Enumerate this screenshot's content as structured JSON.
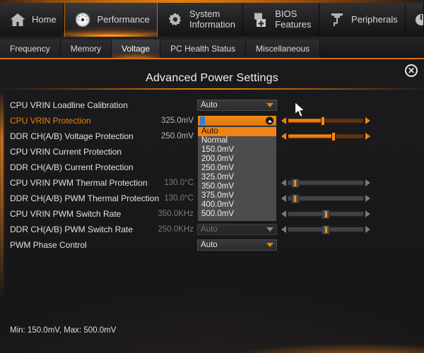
{
  "mainnav": [
    {
      "label": "Home",
      "icon": "home-icon",
      "active": false
    },
    {
      "label": "Performance",
      "icon": "gauge-icon",
      "active": true
    },
    {
      "label": "System\nInformation",
      "icon": "gear-icon",
      "active": false
    },
    {
      "label": "BIOS\nFeatures",
      "icon": "chip-plus-icon",
      "active": false
    },
    {
      "label": "Peripherals",
      "icon": "usb-plug-icon",
      "active": false
    },
    {
      "label": "",
      "icon": "power-icon",
      "active": false
    }
  ],
  "subtabs": [
    {
      "label": "Frequency",
      "active": false
    },
    {
      "label": "Memory",
      "active": false
    },
    {
      "label": "Voltage",
      "active": true
    },
    {
      "label": "PC Health Status",
      "active": false
    },
    {
      "label": "Miscellaneous",
      "active": false
    }
  ],
  "panel": {
    "title": "Advanced Power Settings",
    "close_label": "✕"
  },
  "settings": [
    {
      "label": "CPU VRIN Loadline Calibration",
      "value": "",
      "control": "combo",
      "combo_value": "Auto",
      "disabled": false,
      "selected": false,
      "slider": null
    },
    {
      "label": "CPU VRIN Protection",
      "value": "325.0mV",
      "control": "combo-open",
      "combo_value": "",
      "disabled": false,
      "selected": true,
      "slider": {
        "fill": 0.46,
        "knob": 0.46,
        "hot": true
      }
    },
    {
      "label": "DDR CH(A/B) Voltage Protection",
      "value": "250.0mV",
      "control": "none",
      "combo_value": "",
      "disabled": false,
      "selected": false,
      "slider": {
        "fill": 0.6,
        "knob": 0.6,
        "hot": true
      }
    },
    {
      "label": "CPU VRIN Current Protection",
      "value": "",
      "control": "none",
      "combo_value": "",
      "disabled": false,
      "selected": false,
      "slider": null
    },
    {
      "label": "DDR CH(A/B) Current Protection",
      "value": "",
      "control": "none",
      "combo_value": "",
      "disabled": false,
      "selected": false,
      "slider": null
    },
    {
      "label": "CPU VRIN PWM Thermal Protection",
      "value": "130.0°C",
      "control": "none",
      "combo_value": "",
      "disabled": true,
      "selected": false,
      "slider": {
        "fill": 0,
        "knob": 0.09,
        "hot": false
      }
    },
    {
      "label": "DDR CH(A/B) PWM Thermal Protection",
      "value": "130.0°C",
      "control": "none",
      "combo_value": "",
      "disabled": true,
      "selected": false,
      "slider": {
        "fill": 0,
        "knob": 0.09,
        "hot": false
      }
    },
    {
      "label": "CPU VRIN PWM Switch Rate",
      "value": "350.0KHz",
      "control": "none",
      "combo_value": "",
      "disabled": true,
      "selected": false,
      "slider": {
        "fill": 0,
        "knob": 0.5,
        "hot": false
      }
    },
    {
      "label": "DDR CH(A/B) PWM Switch Rate",
      "value": "250.0KHz",
      "control": "combo",
      "combo_value": "Auto",
      "disabled": true,
      "selected": false,
      "slider": {
        "fill": 0,
        "knob": 0.5,
        "hot": false
      }
    },
    {
      "label": "PWM Phase Control",
      "value": "",
      "control": "combo",
      "combo_value": "Auto",
      "disabled": false,
      "selected": false,
      "slider": null
    }
  ],
  "dropdown": {
    "open": true,
    "selected_index": 0,
    "options": [
      "Auto",
      "Normal",
      "150.0mV",
      "200.0mV",
      "250.0mV",
      "325.0mV",
      "350.0mV",
      "375.0mV",
      "400.0mV",
      "500.0mV"
    ]
  },
  "footer": {
    "text": "Min: 150.0mV, Max: 500.0mV"
  },
  "colors": {
    "accent": "#e8820f",
    "accent_bright": "#ff931f",
    "selected_text": "#e8820f",
    "panel_bg": "#1a191b",
    "dropdown_bg": "#4c4c4e",
    "blue_marker": "#2f7fd8"
  }
}
